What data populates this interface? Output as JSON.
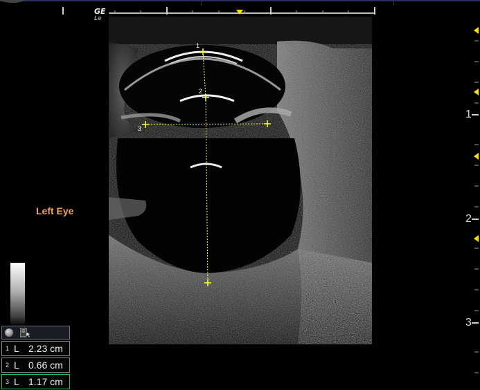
{
  "header": {
    "logo": "GE",
    "logo_sub": "Le"
  },
  "annotation": {
    "text": "Left Eye",
    "color": "#f2a25a"
  },
  "depth_scale": [
    "1",
    "2",
    "3"
  ],
  "caliper_labels": [
    "1",
    "2",
    "3"
  ],
  "measurements": [
    {
      "index": "1",
      "type": "L",
      "value": "2.23 cm",
      "active": false
    },
    {
      "index": "2",
      "type": "L",
      "value": "0.66 cm",
      "active": false
    },
    {
      "index": "3",
      "type": "L",
      "value": "1.17 cm",
      "active": true
    }
  ],
  "colors": {
    "caliper": "#ffff3c",
    "focus_marker": "#ffe000",
    "active_border": "#2fbf57"
  },
  "icons": {
    "gray-map-icon": "circle",
    "caliper-tool-icon": "hand-cursor"
  }
}
